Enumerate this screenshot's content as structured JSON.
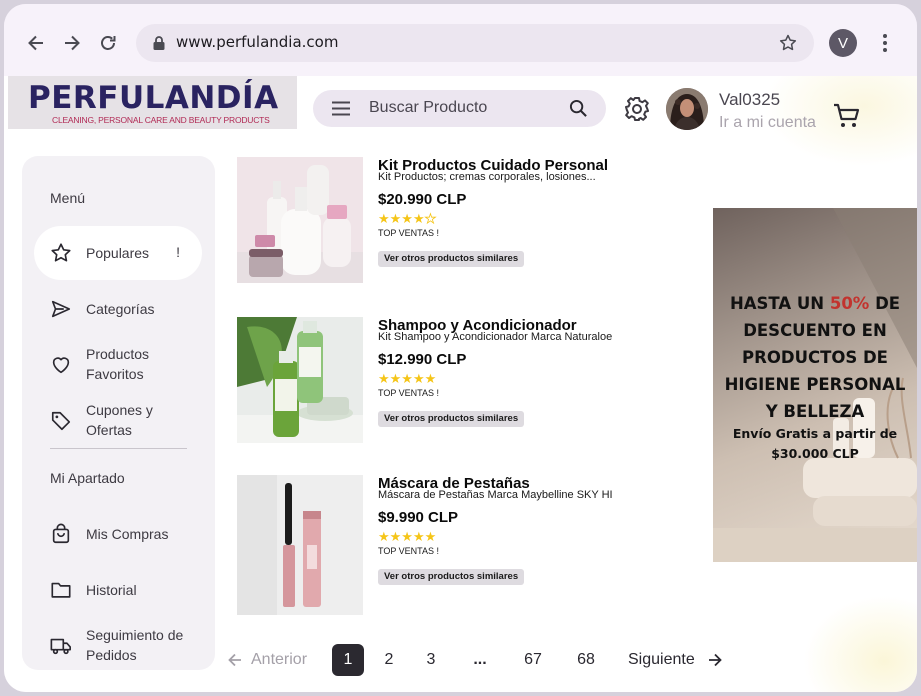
{
  "browser": {
    "url": "www.perfulandia.com",
    "profile_initial": "V"
  },
  "header": {
    "brand": "PERFULANDÍA",
    "tagline": "CLEANING, PERSONAL CARE AND BEAUTY PRODUCTS",
    "search_placeholder": "Buscar Producto",
    "username": "Val0325",
    "account_link": "Ir a mi cuenta"
  },
  "sidebar": {
    "heading_menu": "Menú",
    "items_menu": [
      {
        "label": "Populares",
        "badge": "!",
        "icon": "star-icon",
        "active": true
      },
      {
        "label": "Categorías",
        "icon": "send-icon"
      },
      {
        "label": "Productos Favoritos",
        "icon": "heart-icon"
      },
      {
        "label": "Cupones y Ofertas",
        "icon": "tag-icon"
      }
    ],
    "heading_mine": "Mi Apartado",
    "items_mine": [
      {
        "label": "Mis Compras",
        "icon": "shopping-bag-icon"
      },
      {
        "label": "Historial",
        "icon": "folder-icon"
      },
      {
        "label": "Seguimiento de Pedidos",
        "icon": "truck-icon"
      }
    ]
  },
  "products": [
    {
      "name": "Kit Productos Cuidado Personal",
      "desc": "Kit Productos; cremas corporales, losiones...",
      "price": "$20.990 CLP",
      "rating": 4,
      "badge": "TOP VENTAS !",
      "button": "Ver otros productos similares"
    },
    {
      "name": "Shampoo y Acondicionador",
      "desc": "Kit Shampoo y Acondicionador Marca Naturaloe",
      "price": "$12.990 CLP",
      "rating": 5,
      "badge": "TOP VENTAS !",
      "button": "Ver otros productos similares"
    },
    {
      "name": "Máscara de Pestañas",
      "desc": "Máscara de Pestañas Marca Maybelline SKY HI",
      "price": "$9.990 CLP",
      "rating": 5,
      "badge": "TOP VENTAS !",
      "button": "Ver otros productos similares"
    }
  ],
  "banner": {
    "line1a": "HASTA UN ",
    "line1b": "50%",
    "line1c": " DE",
    "line2": "DESCUENTO EN",
    "line3": "PRODUCTOS DE",
    "line4": "HIGIENE PERSONAL",
    "line5": "Y BELLEZA",
    "sub1": "Envío Gratis a partir de",
    "sub2": "$30.000 CLP",
    "highlight_color": "#c2332e"
  },
  "pagination": {
    "prev": "Anterior",
    "pages": [
      "1",
      "2",
      "3",
      "...",
      "67",
      "68"
    ],
    "current": "1",
    "next": "Siguiente"
  }
}
